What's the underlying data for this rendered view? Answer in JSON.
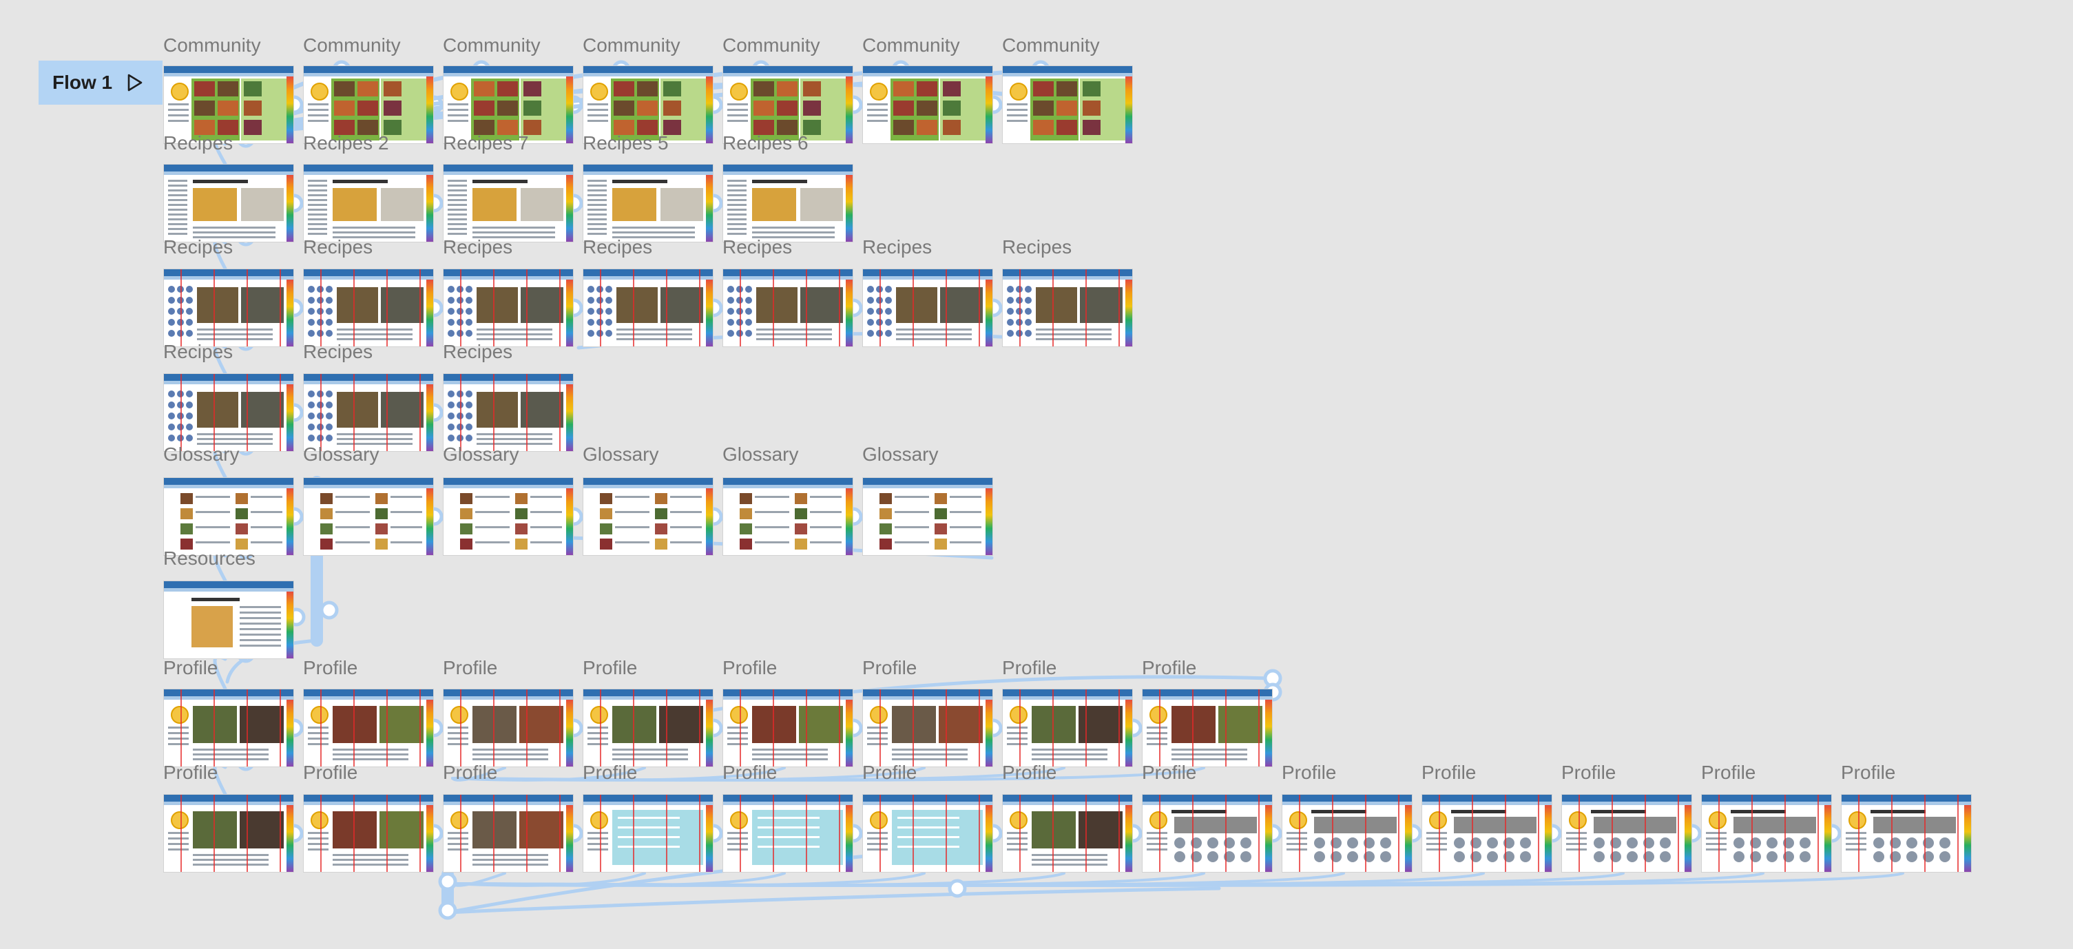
{
  "flow": {
    "label": "Flow 1"
  },
  "icons": {
    "play": "play-icon"
  },
  "colors": {
    "canvas": "#e5e5e5",
    "connector": "#b0d0f2",
    "flow_badge": "#b3d4f4",
    "frame_title": "#7a7a7a",
    "guide_red": "#e62828"
  },
  "rows": [
    {
      "titles": [
        "Community",
        "Community",
        "Community",
        "Community",
        "Community",
        "Community",
        "Community"
      ],
      "kind": "community"
    },
    {
      "titles": [
        "Recipes",
        "Recipes 2",
        "Recipes 7",
        "Recipes 5",
        "Recipes 6"
      ],
      "kind": "recipes-doc"
    },
    {
      "titles": [
        "Recipes",
        "Recipes",
        "Recipes",
        "Recipes",
        "Recipes",
        "Recipes",
        "Recipes"
      ],
      "kind": "recipes-grid"
    },
    {
      "titles": [
        "Recipes",
        "Recipes",
        "Recipes"
      ],
      "kind": "recipes-grid"
    },
    {
      "titles": [
        "Glossary",
        "Glossary",
        "Glossary",
        "Glossary",
        "Glossary",
        "Glossary"
      ],
      "kind": "glossary"
    },
    {
      "titles": [
        "Resources"
      ],
      "kind": "resources"
    },
    {
      "titles": [
        "Profile",
        "Profile",
        "Profile",
        "Profile",
        "Profile",
        "Profile",
        "Profile",
        "Profile"
      ],
      "kind": "profile"
    },
    {
      "titles": [
        "Profile",
        "Profile",
        "Profile",
        "Profile",
        "Profile",
        "Profile",
        "Profile",
        "Profile",
        "Profile",
        "Profile",
        "Profile",
        "Profile",
        "Profile"
      ],
      "kind": "profile2"
    }
  ]
}
